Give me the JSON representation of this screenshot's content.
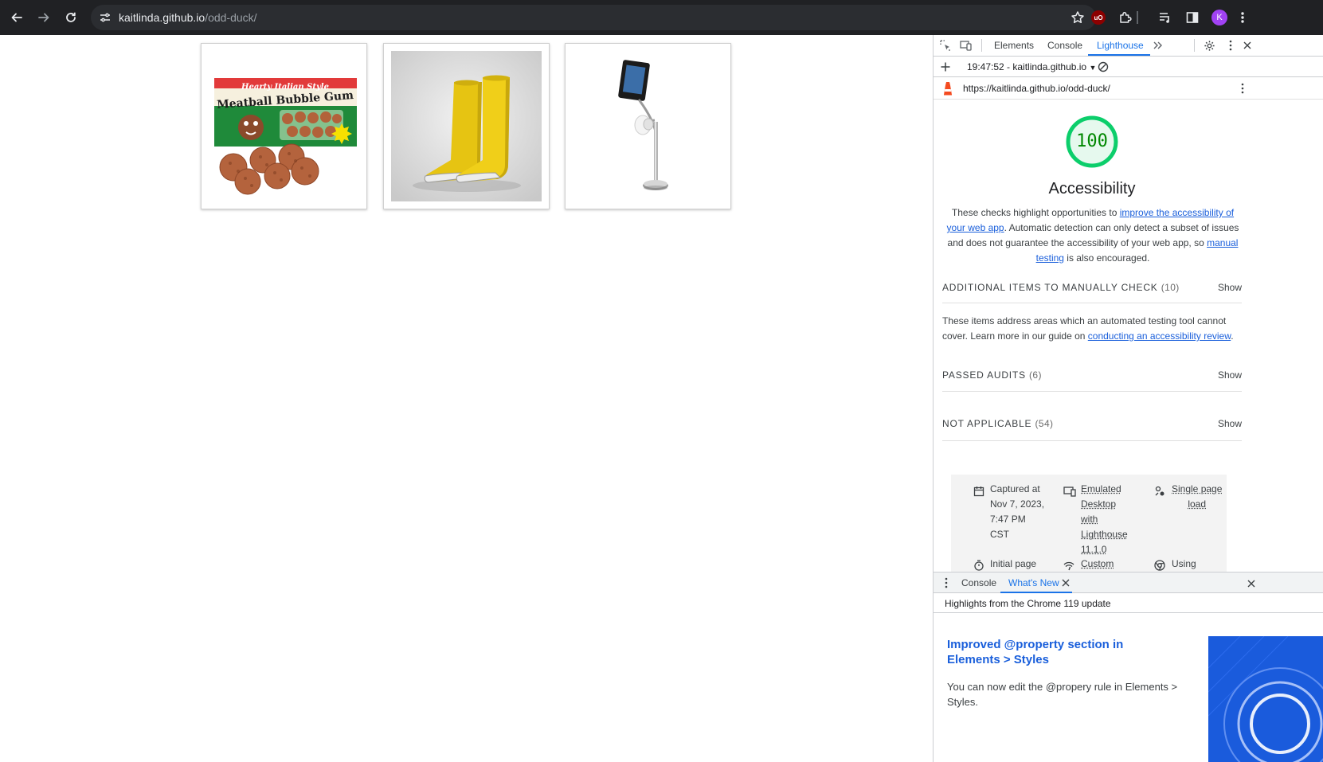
{
  "browser": {
    "url_host": "kaitlinda.github.io",
    "url_path": "/odd-duck/",
    "profile_initial": "K",
    "ublock_badge": "uO",
    "icons": [
      "back-icon",
      "forward-icon",
      "reload-icon",
      "site-info-icon",
      "bookmark-star-icon",
      "extensions-icon",
      "media-queue-icon",
      "side-panel-icon",
      "menu-icon"
    ]
  },
  "page": {
    "products": [
      {
        "name": "meatball-bubble-gum",
        "box_line1": "Hearty Italian Style",
        "box_line2": "Meatball Bubble Gum"
      },
      {
        "name": "yellow-boots"
      },
      {
        "name": "tablet-toilet-paper-stand"
      }
    ]
  },
  "devtools": {
    "tabs": [
      "Elements",
      "Console",
      "Lighthouse"
    ],
    "active_tab": "Lighthouse",
    "lighthouse": {
      "report_selector": "19:47:52 - kaitlinda.github.io",
      "report_url": "https://kaitlinda.github.io/odd-duck/",
      "score": "100",
      "category": "Accessibility",
      "desc_part1": "These checks highlight opportunities to ",
      "desc_link1": "improve the accessibility of your web app",
      "desc_part2": ". Automatic detection can only detect a subset of issues and does not guarantee the accessibility of your web app, so ",
      "desc_link2": "manual testing",
      "desc_part3": " is also encouraged.",
      "groups": [
        {
          "title": "Additional items to manually check",
          "count": "(10)",
          "show": "Show"
        },
        {
          "title": "Passed audits",
          "count": "(6)",
          "show": "Show"
        },
        {
          "title": "Not applicable",
          "count": "(54)",
          "show": "Show"
        }
      ],
      "manual_desc_part1": "These items address areas which an automated testing tool cannot cover. Learn more in our guide on ",
      "manual_desc_link": "conducting an accessibility review",
      "manual_desc_part2": ".",
      "meta": {
        "captured": [
          "Captured at",
          "Nov 7, 2023,",
          "7:47 PM",
          "CST"
        ],
        "emulated": [
          "Emulated",
          "Desktop",
          "with",
          "Lighthouse",
          "11.1.0"
        ],
        "single": [
          "Single page",
          "load"
        ],
        "initial": "Initial page",
        "custom": "Custom",
        "using": "Using"
      }
    },
    "drawer": {
      "tabs": [
        "Console",
        "What's New"
      ],
      "active_tab": "What's New",
      "subheader": "Highlights from the Chrome 119 update",
      "feature_title": "Improved @property section in Elements > Styles",
      "feature_body": "You can now edit the @propery rule in Elements > Styles."
    }
  },
  "colors": {
    "chrome_bg": "#202124",
    "omnibox_bg": "#2b2d31",
    "accent": "#1a73e8",
    "score_green": "#0cce6b",
    "link": "#1a5fdb"
  }
}
